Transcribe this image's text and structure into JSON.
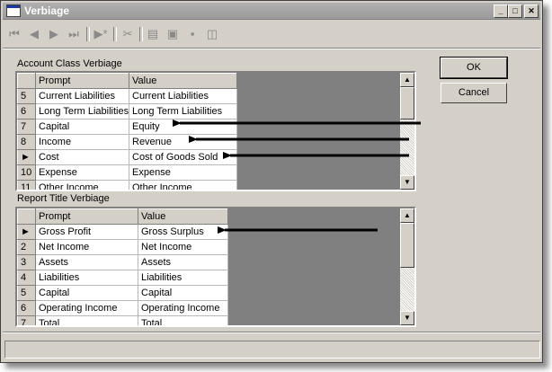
{
  "window": {
    "title": "Verbiage"
  },
  "toolbar": {
    "icons": [
      "first-record-icon",
      "prev-record-icon",
      "next-record-icon",
      "last-record-icon",
      "new-record-icon",
      "delete-icon",
      "print-preview-icon",
      "save-icon",
      "cancel-edit-icon",
      "properties-icon"
    ]
  },
  "account_class": {
    "label": "Account Class Verbiage",
    "headers": {
      "prompt": "Prompt",
      "value": "Value"
    },
    "rows": [
      {
        "id": "5",
        "prompt": "Current Liabilities",
        "value": "Current Liabilities"
      },
      {
        "id": "6",
        "prompt": "Long Term Liabilities",
        "value": "Long Term Liabilities"
      },
      {
        "id": "7",
        "prompt": "Capital",
        "value": "Equity"
      },
      {
        "id": "8",
        "prompt": "Income",
        "value": "Revenue"
      },
      {
        "id": "►",
        "prompt": "Cost",
        "value": "Cost of Goods Sold"
      },
      {
        "id": "10",
        "prompt": "Expense",
        "value": "Expense"
      },
      {
        "id": "11",
        "prompt": "Other Income",
        "value": "Other Income"
      }
    ]
  },
  "report_title": {
    "label": "Report Title Verbiage",
    "headers": {
      "prompt": "Prompt",
      "value": "Value"
    },
    "rows": [
      {
        "id": "►",
        "prompt": "Gross Profit",
        "value": "Gross Surplus"
      },
      {
        "id": "2",
        "prompt": "Net Income",
        "value": "Net Income"
      },
      {
        "id": "3",
        "prompt": "Assets",
        "value": "Assets"
      },
      {
        "id": "4",
        "prompt": "Liabilities",
        "value": "Liabilities"
      },
      {
        "id": "5",
        "prompt": "Capital",
        "value": "Capital"
      },
      {
        "id": "6",
        "prompt": "Operating Income",
        "value": "Operating Income"
      },
      {
        "id": "7",
        "prompt": "Total",
        "value": "Total"
      }
    ]
  },
  "buttons": {
    "ok": "OK",
    "cancel": "Cancel"
  }
}
